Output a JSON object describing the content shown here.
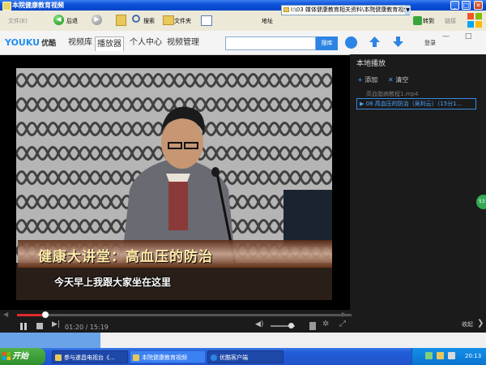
{
  "window": {
    "title": "本院健康教育视频",
    "min_label": "_",
    "max_label": "□",
    "close_label": "×"
  },
  "ie_toolbar": {
    "file_menu": "文件(E)",
    "back_label": "后退",
    "search_label": "搜索",
    "folders_label": "文件夹",
    "address_label": "地址",
    "address_value": "I:\\03 媒体健康教育相关资料\\本院健康教育视频",
    "go_label": "转到",
    "links_label": "链接"
  },
  "youku": {
    "logo_text": "YOUKU",
    "logo_cn": "优酷",
    "tabs": [
      {
        "label": "视频库"
      },
      {
        "label": "播放器"
      },
      {
        "label": "个人中心"
      },
      {
        "label": "视频管理"
      }
    ],
    "search_button": "搜库",
    "login_label": "登录",
    "window_buttons": "— □ ×"
  },
  "video": {
    "caption_title": "健康大讲堂：高血压的防治",
    "subtitle": "今天早上我跟大家坐在这里"
  },
  "controls": {
    "current_time": "01:20",
    "total_time": "15:19",
    "time_separator": " / ",
    "progress_fraction": 0.085,
    "list_toggle": "收起"
  },
  "playlist": {
    "title": "本地播放",
    "add_label": "添加",
    "clear_label": "清空",
    "items": [
      {
        "label": "高血脂病教程1.mp4"
      },
      {
        "label": "08 高血压的防治（吴利云）（15分1..."
      }
    ]
  },
  "taskbar": {
    "start_label": "开始",
    "tasks": [
      {
        "label": "参与遂昌电视台《..."
      },
      {
        "label": "本院健康教育视频"
      },
      {
        "label": "优酷客户端"
      }
    ],
    "clock": "20:13"
  }
}
